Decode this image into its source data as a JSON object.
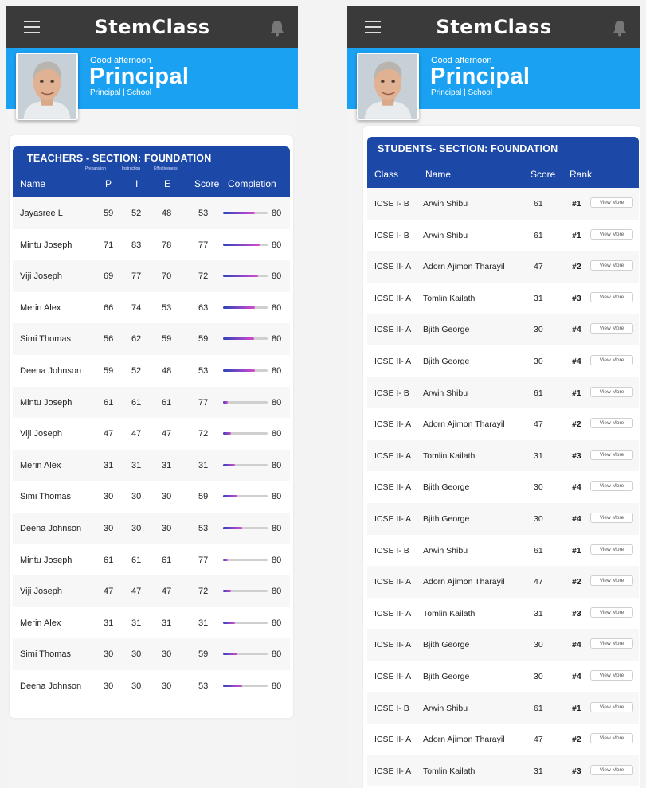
{
  "app": {
    "brand": "StemClass",
    "greeting": "Good afternoon",
    "role": "Principal",
    "subtitle": "Principal | School"
  },
  "icons": {
    "menu": "hamburger-menu-icon",
    "bell": "notification-bell-icon"
  },
  "colors": {
    "topbar": "#3a3a3a",
    "hero": "#1ba1f2",
    "table_header": "#1c48a8"
  },
  "teachers": {
    "title": "TEACHERS - SECTION: FOUNDATION",
    "headers": {
      "name": "Name",
      "prep_small": "Preparation",
      "prep": "P",
      "instr_small": "Instruction",
      "instr": "I",
      "eff_small": "Effectiveness",
      "eff": "E",
      "score": "Score",
      "completion": "Completion"
    },
    "rows": [
      {
        "name": "Jayasree L",
        "p": "59",
        "i": "52",
        "e": "48",
        "score": "53",
        "progress": 0.72,
        "completion": "80"
      },
      {
        "name": "Mintu Joseph",
        "p": "71",
        "i": "83",
        "e": "78",
        "score": "77",
        "progress": 0.82,
        "completion": "80"
      },
      {
        "name": "Viji Joseph",
        "p": "69",
        "i": "77",
        "e": "70",
        "score": "72",
        "progress": 0.78,
        "completion": "80"
      },
      {
        "name": "Merin Alex",
        "p": "66",
        "i": "74",
        "e": "53",
        "score": "63",
        "progress": 0.72,
        "completion": "80"
      },
      {
        "name": "Simi Thomas",
        "p": "56",
        "i": "62",
        "e": "59",
        "score": "59",
        "progress": 0.7,
        "completion": "80"
      },
      {
        "name": "Deena Johnson",
        "p": "59",
        "i": "52",
        "e": "48",
        "score": "53",
        "progress": 0.72,
        "completion": "80"
      },
      {
        "name": "Mintu Joseph",
        "p": "61",
        "i": "61",
        "e": "61",
        "score": "77",
        "progress": 0.1,
        "completion": "80"
      },
      {
        "name": "Viji Joseph",
        "p": "47",
        "i": "47",
        "e": "47",
        "score": "72",
        "progress": 0.18,
        "completion": "80"
      },
      {
        "name": "Merin Alex",
        "p": "31",
        "i": "31",
        "e": "31",
        "score": "31",
        "progress": 0.26,
        "completion": "80"
      },
      {
        "name": "Simi Thomas",
        "p": "30",
        "i": "30",
        "e": "30",
        "score": "59",
        "progress": 0.32,
        "completion": "80"
      },
      {
        "name": "Deena Johnson",
        "p": "30",
        "i": "30",
        "e": "30",
        "score": "53",
        "progress": 0.42,
        "completion": "80"
      },
      {
        "name": "Mintu Joseph",
        "p": "61",
        "i": "61",
        "e": "61",
        "score": "77",
        "progress": 0.1,
        "completion": "80"
      },
      {
        "name": "Viji Joseph",
        "p": "47",
        "i": "47",
        "e": "47",
        "score": "72",
        "progress": 0.18,
        "completion": "80"
      },
      {
        "name": "Merin Alex",
        "p": "31",
        "i": "31",
        "e": "31",
        "score": "31",
        "progress": 0.26,
        "completion": "80"
      },
      {
        "name": "Simi Thomas",
        "p": "30",
        "i": "30",
        "e": "30",
        "score": "59",
        "progress": 0.32,
        "completion": "80"
      },
      {
        "name": "Deena Johnson",
        "p": "30",
        "i": "30",
        "e": "30",
        "score": "53",
        "progress": 0.42,
        "completion": "80"
      }
    ]
  },
  "students": {
    "title": "STUDENTS- SECTION: FOUNDATION",
    "headers": {
      "class": "Class",
      "name": "Name",
      "score": "Score",
      "rank": "Rank"
    },
    "view_more_label": "View More",
    "rows": [
      {
        "class": "ICSE I- B",
        "name": "Arwin Shibu",
        "score": "61",
        "rank": "#1"
      },
      {
        "class": "ICSE I- B",
        "name": "Arwin Shibu",
        "score": "61",
        "rank": "#1"
      },
      {
        "class": "ICSE II- A",
        "name": "Adorn Ajimon Tharayil",
        "score": "47",
        "rank": "#2"
      },
      {
        "class": "ICSE II- A",
        "name": "Tomlin Kailath",
        "score": "31",
        "rank": "#3"
      },
      {
        "class": "ICSE II- A",
        "name": "Bjith George",
        "score": "30",
        "rank": "#4"
      },
      {
        "class": "ICSE II- A",
        "name": "Bjith George",
        "score": "30",
        "rank": "#4"
      },
      {
        "class": "ICSE I- B",
        "name": "Arwin Shibu",
        "score": "61",
        "rank": "#1"
      },
      {
        "class": "ICSE II- A",
        "name": "Adorn Ajimon Tharayil",
        "score": "47",
        "rank": "#2"
      },
      {
        "class": "ICSE II- A",
        "name": "Tomlin Kailath",
        "score": "31",
        "rank": "#3"
      },
      {
        "class": "ICSE II- A",
        "name": "Bjith George",
        "score": "30",
        "rank": "#4"
      },
      {
        "class": "ICSE II- A",
        "name": "Bjith George",
        "score": "30",
        "rank": "#4"
      },
      {
        "class": "ICSE I- B",
        "name": "Arwin Shibu",
        "score": "61",
        "rank": "#1"
      },
      {
        "class": "ICSE II- A",
        "name": "Adorn Ajimon Tharayil",
        "score": "47",
        "rank": "#2"
      },
      {
        "class": "ICSE II- A",
        "name": "Tomlin Kailath",
        "score": "31",
        "rank": "#3"
      },
      {
        "class": "ICSE II- A",
        "name": "Bjith George",
        "score": "30",
        "rank": "#4"
      },
      {
        "class": "ICSE II- A",
        "name": "Bjith George",
        "score": "30",
        "rank": "#4"
      },
      {
        "class": "ICSE I- B",
        "name": "Arwin Shibu",
        "score": "61",
        "rank": "#1"
      },
      {
        "class": "ICSE II- A",
        "name": "Adorn Ajimon Tharayil",
        "score": "47",
        "rank": "#2"
      },
      {
        "class": "ICSE II- A",
        "name": "Tomlin Kailath",
        "score": "31",
        "rank": "#3"
      }
    ]
  }
}
